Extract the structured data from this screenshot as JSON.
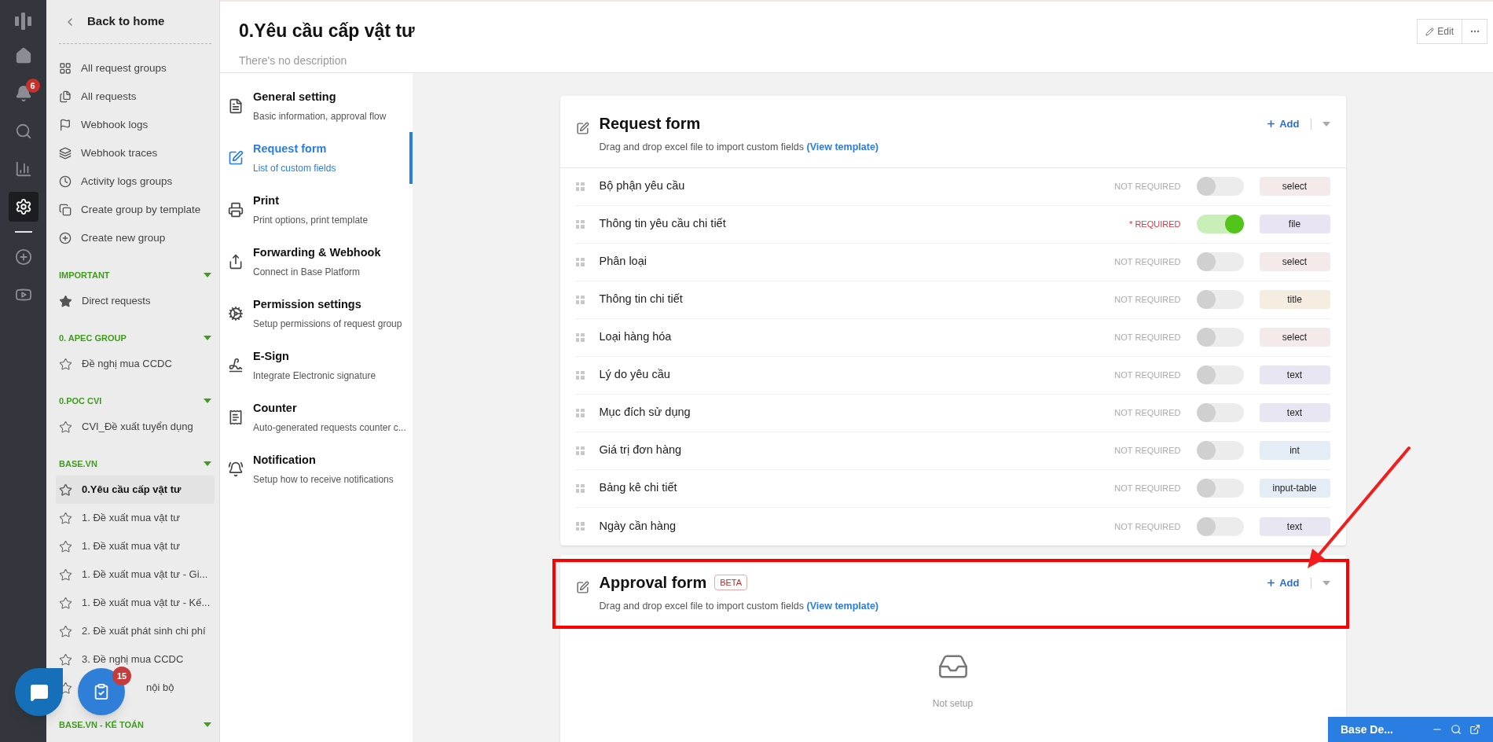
{
  "rail": {
    "items": [
      {
        "kind": "logo"
      },
      {
        "kind": "home",
        "selected": false
      },
      {
        "kind": "bell",
        "badge": "6",
        "selected": false
      },
      {
        "kind": "search",
        "selected": false
      },
      {
        "kind": "chart",
        "selected": false
      },
      {
        "kind": "settings",
        "selected": true
      },
      {
        "kind": "divider"
      },
      {
        "kind": "add",
        "selected": false
      },
      {
        "kind": "play",
        "selected": false
      }
    ]
  },
  "sidebar": {
    "back": "Back to home",
    "nav": [
      {
        "kind": "grid",
        "label": "All request groups"
      },
      {
        "kind": "files",
        "label": "All requests"
      },
      {
        "kind": "flag",
        "label": "Webhook logs"
      },
      {
        "kind": "layers",
        "label": "Webhook traces"
      },
      {
        "kind": "clock",
        "label": "Activity logs groups"
      },
      {
        "kind": "template",
        "label": "Create group by template"
      },
      {
        "kind": "add",
        "label": "Create new group"
      }
    ],
    "groups": [
      {
        "title": "IMPORTANT",
        "expanded": true,
        "items": [
          {
            "label": "Direct requests",
            "starred": true,
            "selected": false
          }
        ]
      },
      {
        "title": "0. APEC GROUP",
        "expanded": true,
        "items": [
          {
            "label": "Đề nghị mua CCDC",
            "starred": false,
            "selected": false
          }
        ]
      },
      {
        "title": "0.POC CVI",
        "expanded": true,
        "items": [
          {
            "label": "CVI_Đề xuất tuyển dụng",
            "starred": false,
            "selected": false
          }
        ]
      },
      {
        "title": "BASE.VN",
        "expanded": true,
        "items": [
          {
            "label": "0.Yêu cầu cấp vật tư",
            "starred": false,
            "selected": true
          },
          {
            "label": "1. Đề xuất mua vật tư",
            "starred": false,
            "selected": false
          },
          {
            "label": "1. Đề xuất mua vật tư",
            "starred": false,
            "selected": false
          },
          {
            "label": "1. Đề xuất mua vật tư - Gi...",
            "starred": false,
            "selected": false
          },
          {
            "label": "1. Đề xuất mua vật tư - Kế...",
            "starred": false,
            "selected": false
          },
          {
            "label": "2. Đề xuất phát sinh chi phí",
            "starred": false,
            "selected": false
          },
          {
            "label": "3. Đề nghị mua CCDC",
            "starred": false,
            "selected": false
          },
          {
            "label": "nội bộ",
            "starred": false,
            "selected": false,
            "covered": true
          }
        ]
      },
      {
        "title": "BASE.VN - KẾ TOÁN",
        "expanded": true
      }
    ]
  },
  "header": {
    "title": "0.Yêu cầu cấp vật tư",
    "description": "There's no description",
    "edit": "Edit"
  },
  "menu": [
    {
      "kind": "general",
      "title": "General setting",
      "subtitle": "Basic information, approval flow",
      "selected": false
    },
    {
      "kind": "form",
      "title": "Request form",
      "subtitle": "List of custom fields",
      "selected": true
    },
    {
      "kind": "print",
      "title": "Print",
      "subtitle": "Print options, print template",
      "selected": false
    },
    {
      "kind": "forward",
      "title": "Forwarding & Webhook",
      "subtitle": "Connect in Base Platform",
      "selected": false
    },
    {
      "kind": "permission",
      "title": "Permission settings",
      "subtitle": "Setup permissions of request group",
      "selected": false
    },
    {
      "kind": "esign",
      "title": "E-Sign",
      "subtitle": "Integrate Electronic signature",
      "selected": false
    },
    {
      "kind": "counter",
      "title": "Counter",
      "subtitle": "Auto-generated requests counter c...",
      "selected": false
    },
    {
      "kind": "notification",
      "title": "Notification",
      "subtitle": "Setup how to receive notifications",
      "selected": false
    }
  ],
  "request_form": {
    "title": "Request form",
    "description": "Drag and drop excel file to import custom fields",
    "link": "(View template)",
    "add": "Add",
    "fields": [
      {
        "name": "Bộ phận yêu cầu",
        "requirement": "NOT REQUIRED",
        "required": false,
        "type": "select",
        "color": "#f4eaea"
      },
      {
        "name": "Thông tin yêu cầu chi tiết",
        "requirement": "* REQUIRED",
        "required": true,
        "type": "file",
        "color": "#e9e4f3"
      },
      {
        "name": "Phân loại",
        "requirement": "NOT REQUIRED",
        "required": false,
        "type": "select",
        "color": "#f4eaea"
      },
      {
        "name": "Thông tin chi tiết",
        "requirement": "NOT REQUIRED",
        "required": false,
        "type": "title",
        "color": "#f5eddf"
      },
      {
        "name": "Loại hàng hóa",
        "requirement": "NOT REQUIRED",
        "required": false,
        "type": "select",
        "color": "#f4eaea"
      },
      {
        "name": "Lý do yêu cầu",
        "requirement": "NOT REQUIRED",
        "required": false,
        "type": "text",
        "color": "#e8e6f2"
      },
      {
        "name": "Mục đích sử dụng",
        "requirement": "NOT REQUIRED",
        "required": false,
        "type": "text",
        "color": "#e8e6f2"
      },
      {
        "name": "Giá trị đơn hàng",
        "requirement": "NOT REQUIRED",
        "required": false,
        "type": "int",
        "color": "#e4ecf5"
      },
      {
        "name": "Bảng kê chi tiết",
        "requirement": "NOT REQUIRED",
        "required": false,
        "type": "input-table",
        "color": "#e4ecf5"
      },
      {
        "name": "Ngày cần hàng",
        "requirement": "NOT REQUIRED",
        "required": false,
        "type": "text",
        "color": "#e8e6f2"
      }
    ]
  },
  "approval_form": {
    "title": "Approval form",
    "badge": "BETA",
    "description": "Drag and drop excel file to import custom fields",
    "link": "(View template)",
    "add": "Add",
    "empty": "Not setup"
  },
  "floating": {
    "tasks_badge": "15"
  },
  "chat_widget": {
    "title": "Base De..."
  }
}
